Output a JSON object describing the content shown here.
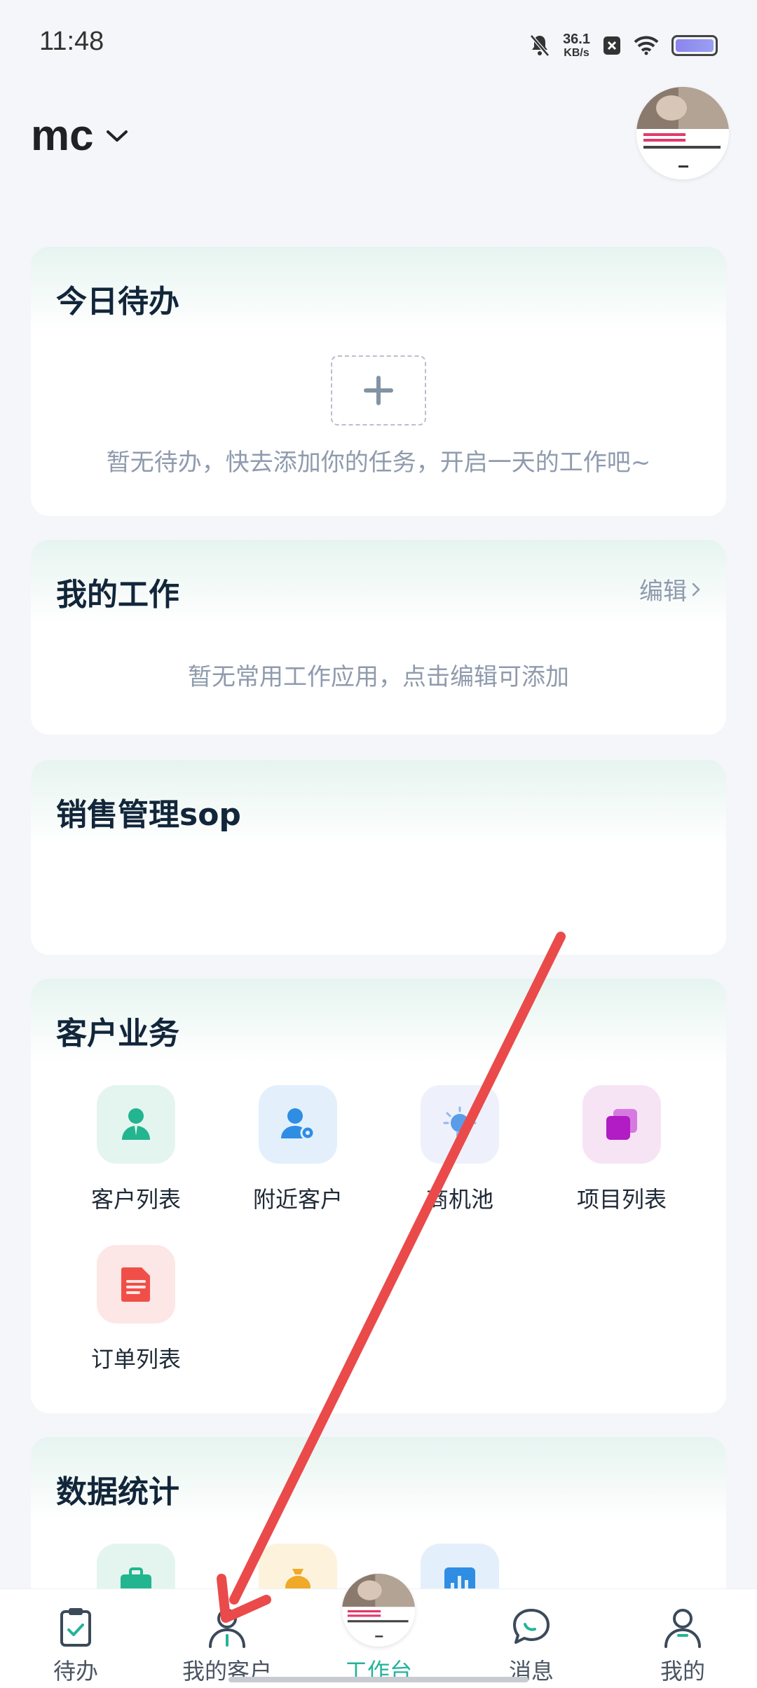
{
  "status_bar": {
    "time": "11:48",
    "net_speed": "36.1",
    "net_unit": "KB/s"
  },
  "header": {
    "account": "mc"
  },
  "todo": {
    "title": "今日待办",
    "empty": "暂无待办，快去添加你的任务，开启一天的工作吧~"
  },
  "work": {
    "title": "我的工作",
    "edit": "编辑",
    "empty": "暂无常用工作应用，点击编辑可添加"
  },
  "sop": {
    "title": "销售管理sop"
  },
  "customer": {
    "title": "客户业务",
    "items": [
      {
        "label": "客户列表",
        "icon": "customer-list-icon",
        "bg": "#e4f5ef",
        "color": "#22b58f"
      },
      {
        "label": "附近客户",
        "icon": "nearby-customer-icon",
        "bg": "#e3f0fb",
        "color": "#2f8de4"
      },
      {
        "label": "商机池",
        "icon": "opportunity-pool-icon",
        "bg": "#eef1fb",
        "color": "#5b9ce8"
      },
      {
        "label": "项目列表",
        "icon": "project-list-icon",
        "bg": "#f6e4f5",
        "color": "#b21cc4"
      },
      {
        "label": "订单列表",
        "icon": "order-list-icon",
        "bg": "#fde6e6",
        "color": "#f04f48"
      }
    ]
  },
  "stats": {
    "title": "数据统计"
  },
  "nav": {
    "items": [
      {
        "label": "待办",
        "icon": "clipboard-check-icon"
      },
      {
        "label": "我的客户",
        "icon": "person-icon"
      },
      {
        "label": "工作台",
        "icon": "workbench-thumbnail"
      },
      {
        "label": "消息",
        "icon": "chat-bubble-icon"
      },
      {
        "label": "我的",
        "icon": "profile-icon"
      }
    ],
    "active": "工作台"
  },
  "colors": {
    "accent": "#25b39a",
    "annotation_arrow": "#ea4a4a"
  }
}
